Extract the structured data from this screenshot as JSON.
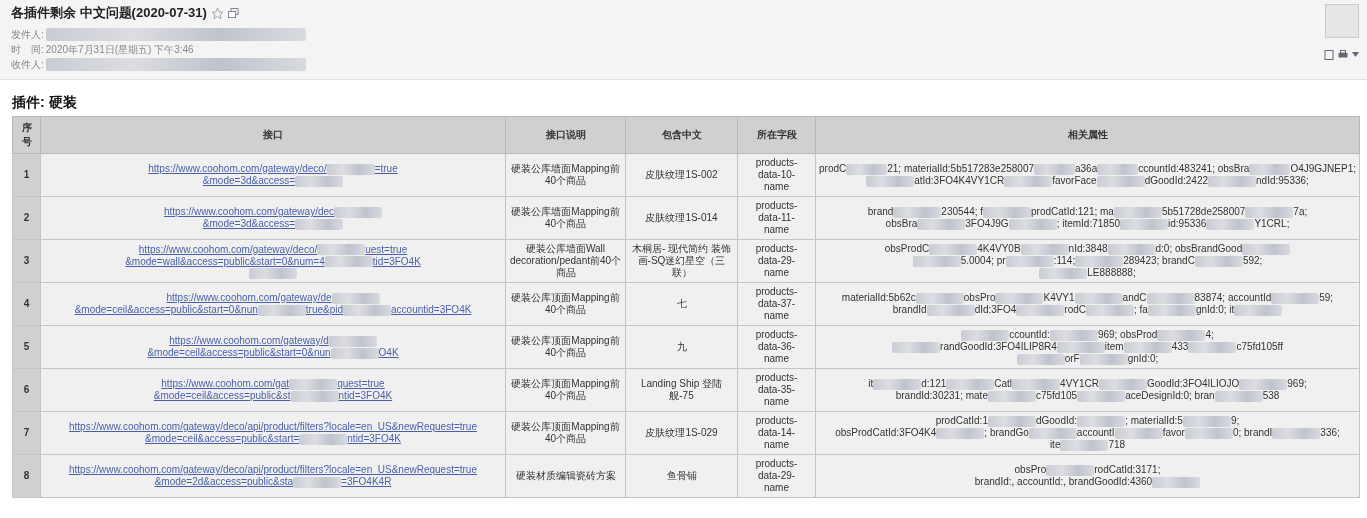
{
  "email": {
    "subject": "各插件剩余 中文问题(2020-07-31)",
    "starred": false,
    "fields": [
      {
        "label": "发件人:",
        "parts": [
          {
            "kind": "redacted"
          }
        ]
      },
      {
        "label": "时　间:",
        "parts": [
          {
            "kind": "text",
            "text": "2020年7月31日(星期五) 下午3:46"
          }
        ]
      },
      {
        "label": "收件人:",
        "parts": [
          {
            "kind": "redacted"
          }
        ]
      }
    ]
  },
  "section_title": "插件: 硬装",
  "table": {
    "columns": [
      "序号",
      "接口",
      "接口说明",
      "包含中文",
      "所在字段",
      "相关属性"
    ],
    "rows": [
      {
        "index": "1",
        "url": [
          [
            {
              "kind": "text",
              "text": "https://www.coohom.com/gateway/deco/"
            },
            {
              "kind": "redacted"
            },
            {
              "kind": "text",
              "text": "=true"
            }
          ],
          [
            {
              "kind": "text",
              "text": "&mode=3d&access="
            },
            {
              "kind": "redacted"
            }
          ]
        ],
        "description": "硬装公库墙面Mapping前40个商品",
        "chinese": "皮肤纹理1S-002",
        "field": "products-data-10-name",
        "attributes": [
          [
            {
              "kind": "text",
              "text": "prodC"
            },
            {
              "kind": "redacted"
            },
            {
              "kind": "text",
              "text": "21; materialId:5b517283e258007"
            },
            {
              "kind": "redacted"
            },
            {
              "kind": "text",
              "text": "a36a"
            },
            {
              "kind": "redacted"
            },
            {
              "kind": "text",
              "text": "ccountId:483241; obsBra"
            },
            {
              "kind": "redacted"
            },
            {
              "kind": "text",
              "text": "O4J9GJNEP1;"
            }
          ],
          [
            {
              "kind": "redacted"
            },
            {
              "kind": "text",
              "text": "atId:3FO4K4VY1CR"
            },
            {
              "kind": "redacted"
            },
            {
              "kind": "text",
              "text": "favorFace"
            },
            {
              "kind": "redacted"
            },
            {
              "kind": "text",
              "text": "dGoodId:2422"
            },
            {
              "kind": "redacted"
            },
            {
              "kind": "text",
              "text": "ndId:95336;"
            }
          ]
        ]
      },
      {
        "index": "2",
        "url": [
          [
            {
              "kind": "text",
              "text": "https://www.coohom.com/gateway/dec"
            },
            {
              "kind": "redacted"
            }
          ],
          [
            {
              "kind": "text",
              "text": "&mode=3d&access="
            },
            {
              "kind": "redacted"
            }
          ]
        ],
        "description": "硬装公库墙面Mapping前40个商品",
        "chinese": "皮肤纹理1S-014",
        "field": "products-data-11-name",
        "attributes": [
          [
            {
              "kind": "text",
              "text": "brand"
            },
            {
              "kind": "redacted"
            },
            {
              "kind": "text",
              "text": "230544; f"
            },
            {
              "kind": "redacted"
            },
            {
              "kind": "text",
              "text": "prodCatId:121; ma"
            },
            {
              "kind": "redacted"
            },
            {
              "kind": "text",
              "text": "5b51728de258007"
            },
            {
              "kind": "redacted"
            },
            {
              "kind": "text",
              "text": "7a;"
            }
          ],
          [
            {
              "kind": "text",
              "text": "obsBra"
            },
            {
              "kind": "redacted"
            },
            {
              "kind": "text",
              "text": "3FO4J9G"
            },
            {
              "kind": "redacted"
            },
            {
              "kind": "text",
              "text": "; itemId:71850"
            },
            {
              "kind": "redacted"
            },
            {
              "kind": "text",
              "text": "id:95336"
            },
            {
              "kind": "redacted"
            },
            {
              "kind": "text",
              "text": "Y1CRL;"
            }
          ]
        ]
      },
      {
        "index": "3",
        "url": [
          [
            {
              "kind": "text",
              "text": "https://www.coohom.com/gateway/deco/"
            },
            {
              "kind": "redacted"
            },
            {
              "kind": "text",
              "text": "uest=true"
            }
          ],
          [
            {
              "kind": "text",
              "text": "&mode=wall&access=public&start=0&num=4"
            },
            {
              "kind": "redacted"
            },
            {
              "kind": "text",
              "text": "tid=3FO4K"
            }
          ],
          [
            {
              "kind": "redacted"
            }
          ]
        ],
        "description": "硬装公库墙面Wall decoration/pedant前40个商品",
        "chinese": "木桐居- 现代简约 装饰画-SQ迷幻星空（三联）",
        "field": "products-data-29-name",
        "attributes": [
          [
            {
              "kind": "text",
              "text": "obsProdC"
            },
            {
              "kind": "redacted"
            },
            {
              "kind": "text",
              "text": "4K4VY0B"
            },
            {
              "kind": "redacted"
            },
            {
              "kind": "text",
              "text": "nId:3848"
            },
            {
              "kind": "redacted"
            },
            {
              "kind": "text",
              "text": "d:0; obsBrandGood"
            },
            {
              "kind": "redacted"
            }
          ],
          [
            {
              "kind": "redacted"
            },
            {
              "kind": "text",
              "text": "5.0004; pr"
            },
            {
              "kind": "redacted"
            },
            {
              "kind": "text",
              "text": ":114; "
            },
            {
              "kind": "redacted"
            },
            {
              "kind": "text",
              "text": "289423; brandC"
            },
            {
              "kind": "redacted"
            },
            {
              "kind": "text",
              "text": "592;"
            }
          ],
          [
            {
              "kind": "redacted"
            },
            {
              "kind": "text",
              "text": "LE888888;"
            }
          ]
        ]
      },
      {
        "index": "4",
        "url": [
          [
            {
              "kind": "text",
              "text": "https://www.coohom.com/gateway/de"
            },
            {
              "kind": "redacted"
            }
          ],
          [
            {
              "kind": "text",
              "text": "&mode=ceil&access=public&start=0&nun"
            },
            {
              "kind": "redacted"
            },
            {
              "kind": "text",
              "text": "true&pid"
            },
            {
              "kind": "redacted"
            },
            {
              "kind": "text",
              "text": "accountid=3FO4K"
            }
          ]
        ],
        "description": "硬装公库顶面Mapping前40个商品",
        "chinese": "七",
        "field": "products-data-37-name",
        "attributes": [
          [
            {
              "kind": "text",
              "text": "materialId:5b62c"
            },
            {
              "kind": "redacted"
            },
            {
              "kind": "text",
              "text": "obsPro"
            },
            {
              "kind": "redacted"
            },
            {
              "kind": "text",
              "text": "K4VY1"
            },
            {
              "kind": "redacted"
            },
            {
              "kind": "text",
              "text": "andC"
            },
            {
              "kind": "redacted"
            },
            {
              "kind": "text",
              "text": "83874; accountId"
            },
            {
              "kind": "redacted"
            },
            {
              "kind": "text",
              "text": "59;"
            }
          ],
          [
            {
              "kind": "text",
              "text": "brandId"
            },
            {
              "kind": "redacted"
            },
            {
              "kind": "text",
              "text": "dId:3FO4"
            },
            {
              "kind": "redacted"
            },
            {
              "kind": "text",
              "text": "rodC"
            },
            {
              "kind": "redacted"
            },
            {
              "kind": "text",
              "text": "; fa"
            },
            {
              "kind": "redacted"
            },
            {
              "kind": "text",
              "text": "gnId:0; it"
            },
            {
              "kind": "redacted"
            }
          ]
        ]
      },
      {
        "index": "5",
        "url": [
          [
            {
              "kind": "text",
              "text": "https://www.coohom.com/gateway/d"
            },
            {
              "kind": "redacted"
            }
          ],
          [
            {
              "kind": "text",
              "text": "&mode=ceil&access=public&start=0&nun"
            },
            {
              "kind": "redacted"
            },
            {
              "kind": "text",
              "text": "O4K"
            }
          ]
        ],
        "description": "硬装公库顶面Mapping前40个商品",
        "chinese": "九",
        "field": "products-data-36-name",
        "attributes": [
          [
            {
              "kind": "redacted"
            },
            {
              "kind": "text",
              "text": "ccountId:"
            },
            {
              "kind": "redacted"
            },
            {
              "kind": "text",
              "text": "969; obsProd"
            },
            {
              "kind": "redacted"
            },
            {
              "kind": "text",
              "text": "4;"
            }
          ],
          [
            {
              "kind": "redacted"
            },
            {
              "kind": "text",
              "text": "randGoodId:3FO4ILIP8R4"
            },
            {
              "kind": "redacted"
            },
            {
              "kind": "text",
              "text": "item"
            },
            {
              "kind": "redacted"
            },
            {
              "kind": "text",
              "text": "433"
            },
            {
              "kind": "redacted"
            },
            {
              "kind": "text",
              "text": "c75fd105ff"
            }
          ],
          [
            {
              "kind": "redacted"
            },
            {
              "kind": "text",
              "text": "orF"
            },
            {
              "kind": "redacted"
            },
            {
              "kind": "text",
              "text": "gnId:0;"
            }
          ]
        ]
      },
      {
        "index": "6",
        "url": [
          [
            {
              "kind": "text",
              "text": "https://www.coohom.com/gat"
            },
            {
              "kind": "redacted"
            },
            {
              "kind": "text",
              "text": "quest=true"
            }
          ],
          [
            {
              "kind": "text",
              "text": "&mode=ceil&access=public&st"
            },
            {
              "kind": "redacted"
            },
            {
              "kind": "text",
              "text": "ntid=3FO4K"
            }
          ]
        ],
        "description": "硬装公库顶面Mapping前40个商品",
        "chinese": "Landing Ship 登陆舰-75",
        "field": "products-data-35-name",
        "attributes": [
          [
            {
              "kind": "text",
              "text": "it"
            },
            {
              "kind": "redacted"
            },
            {
              "kind": "text",
              "text": "d:121"
            },
            {
              "kind": "redacted"
            },
            {
              "kind": "text",
              "text": "Catl"
            },
            {
              "kind": "redacted"
            },
            {
              "kind": "text",
              "text": "4VY1CR"
            },
            {
              "kind": "redacted"
            },
            {
              "kind": "text",
              "text": "GoodId:3FO4ILIOJO"
            },
            {
              "kind": "redacted"
            },
            {
              "kind": "text",
              "text": "969;"
            }
          ],
          [
            {
              "kind": "text",
              "text": "brandId:30231; mate"
            },
            {
              "kind": "redacted"
            },
            {
              "kind": "text",
              "text": "c75fd105"
            },
            {
              "kind": "redacted"
            },
            {
              "kind": "text",
              "text": "aceDesignId:0; bran"
            },
            {
              "kind": "redacted"
            },
            {
              "kind": "text",
              "text": "538"
            }
          ]
        ]
      },
      {
        "index": "7",
        "url": [
          [
            {
              "kind": "text",
              "text": "https://www.coohom.com/gateway/deco/api/product/filters?locale=en_US&newRequest=true"
            }
          ],
          [
            {
              "kind": "text",
              "text": "&mode=ceil&access=public&start="
            },
            {
              "kind": "redacted"
            },
            {
              "kind": "text",
              "text": "ntid=3FO4K"
            }
          ]
        ],
        "description": "硬装公库顶面Mapping前40个商品",
        "chinese": "皮肤纹理1S-029",
        "field": "products-data-14-name",
        "attributes": [
          [
            {
              "kind": "text",
              "text": "prodCatId:1"
            },
            {
              "kind": "redacted"
            },
            {
              "kind": "text",
              "text": "dGoodId:"
            },
            {
              "kind": "redacted"
            },
            {
              "kind": "text",
              "text": "; materialId:5"
            },
            {
              "kind": "redacted"
            },
            {
              "kind": "text",
              "text": "9;"
            }
          ],
          [
            {
              "kind": "text",
              "text": "obsProdCatId:3FO4K4"
            },
            {
              "kind": "redacted"
            },
            {
              "kind": "text",
              "text": "; brandGo"
            },
            {
              "kind": "redacted"
            },
            {
              "kind": "text",
              "text": "accountI"
            },
            {
              "kind": "redacted"
            },
            {
              "kind": "text",
              "text": "favor"
            },
            {
              "kind": "redacted"
            },
            {
              "kind": "text",
              "text": "0; brandI"
            },
            {
              "kind": "redacted"
            },
            {
              "kind": "text",
              "text": "336;"
            }
          ],
          [
            {
              "kind": "text",
              "text": "ite"
            },
            {
              "kind": "redacted"
            },
            {
              "kind": "text",
              "text": "718"
            }
          ]
        ]
      },
      {
        "index": "8",
        "url": [
          [
            {
              "kind": "text",
              "text": "https://www.coohom.com/gateway/deco/api/product/filters?locale=en_US&newRequest=true"
            }
          ],
          [
            {
              "kind": "text",
              "text": "&mode=2d&access=public&sta"
            },
            {
              "kind": "redacted"
            },
            {
              "kind": "text",
              "text": "=3FO4K4R"
            }
          ]
        ],
        "description": "硬装材质编辑瓷砖方案",
        "chinese": "鱼骨铺",
        "field": "products-data-29-name",
        "attributes": [
          [
            {
              "kind": "text",
              "text": "obsPro"
            },
            {
              "kind": "redacted"
            },
            {
              "kind": "text",
              "text": "rodCatId:3171;"
            }
          ],
          [
            {
              "kind": "text",
              "text": "brandId:, accountId:, brandGoodId:4360"
            },
            {
              "kind": "redacted"
            }
          ]
        ]
      }
    ]
  }
}
